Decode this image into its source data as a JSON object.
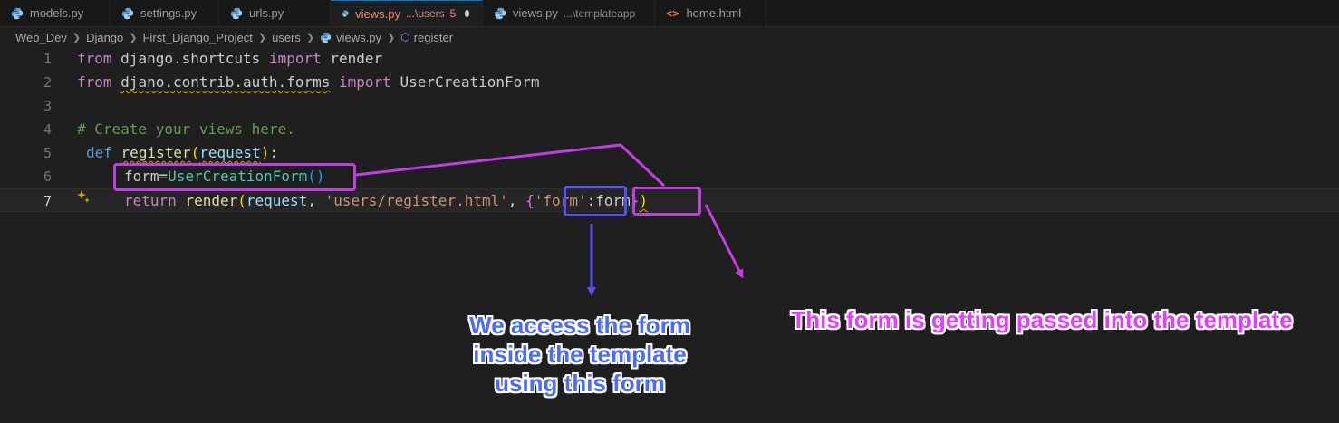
{
  "tabs": [
    {
      "name": "models.py",
      "desc": "",
      "active": false
    },
    {
      "name": "settings.py",
      "desc": "",
      "active": false
    },
    {
      "name": "urls.py",
      "desc": "",
      "active": false
    },
    {
      "name": "views.py",
      "desc": "...\\users",
      "badge": "5",
      "active": true
    },
    {
      "name": "views.py",
      "desc": "...\\templateapp",
      "active": false
    },
    {
      "name": "home.html",
      "desc": "",
      "active": false
    }
  ],
  "breadcrumb": [
    "Web_Dev",
    "Django",
    "First_Django_Project",
    "users",
    "views.py",
    "register"
  ],
  "line_numbers": [
    "1",
    "2",
    "3",
    "4",
    "5",
    "6",
    "7"
  ],
  "code": {
    "l1": {
      "kw_from": "from",
      "mod": "django.shortcuts",
      "kw_import": "import",
      "name": "render"
    },
    "l2": {
      "kw_from": "from",
      "mod": "djano.contrib.auth.forms",
      "kw_import": "import",
      "name": "UserCreationForm"
    },
    "l4": {
      "comment": "# Create your views here."
    },
    "l5": {
      "kw_def": "def",
      "fn": "register",
      "open": "(",
      "param": "request",
      "close": ")",
      "colon": ":"
    },
    "l6": {
      "var": "form",
      "eq": "=",
      "cls": "UserCreationForm",
      "parens": "()"
    },
    "l7": {
      "kw_return": "return",
      "fn": "render",
      "open": "(",
      "param": "request",
      "comma1": ", ",
      "path": "'users/register.html'",
      "comma2": ", ",
      "brace_open": "{",
      "key": "'form'",
      "colon": ":",
      "val": "form",
      "brace_close": "}",
      "close": ")"
    }
  },
  "annotations": {
    "blue_label": [
      "We access the form",
      "inside the template",
      "using this form"
    ],
    "pink_label": "This form is getting passed into the template",
    "colors": {
      "blue": "#4a6cf7",
      "pink": "#c13ee0"
    }
  }
}
